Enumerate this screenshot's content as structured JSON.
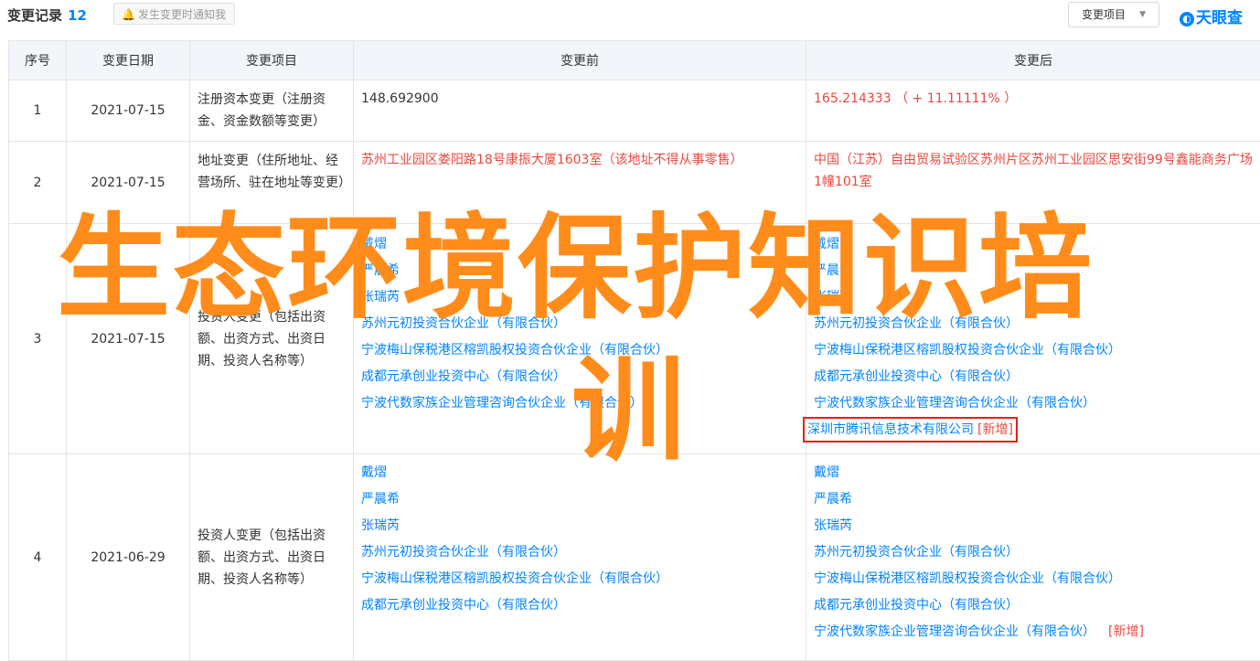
{
  "header": {
    "title": "变更记录",
    "count": "12",
    "notify_label": "发生变更时通知我",
    "filter_label": "变更项目",
    "logo_text": "天眼查"
  },
  "table": {
    "columns": [
      "序号",
      "变更日期",
      "变更项目",
      "变更前",
      "变更后"
    ],
    "rows": [
      {
        "index": "1",
        "date": "2021-07-15",
        "item": "注册资本变更（注册资金、资金数额等变更）",
        "before": [
          "148.692900"
        ],
        "after": [
          "165.214333 （ + 11.11111% ）"
        ]
      },
      {
        "index": "2",
        "date": "2021-07-15",
        "item": "地址变更（住所地址、经营场所、驻在地址等变更）",
        "before": [
          "苏州工业园区娄阳路18号康振大厦1603室（该地址不得从事零售）"
        ],
        "after": [
          "中国（江苏）自由贸易试验区苏州片区苏州工业园区思安街99号鑫能商务广场1幢101室"
        ]
      },
      {
        "index": "3",
        "date": "2021-07-15",
        "item": "投资人变更（包括出资额、出资方式、出资日期、投资人名称等）",
        "before": [
          "戴熠",
          "严晨希",
          "张瑞芮",
          "苏州元初投资合伙企业（有限合伙）",
          "宁波梅山保税港区榕凯股权投资合伙企业（有限合伙）",
          "成都元承创业投资中心（有限合伙）",
          "宁波代数家族企业管理咨询合伙企业（有限合伙）"
        ],
        "after": [
          "戴熠",
          "严晨希",
          "张瑞芮",
          "苏州元初投资合伙企业（有限合伙）",
          "宁波梅山保税港区榕凯股权投资合伙企业（有限合伙）",
          "成都元承创业投资中心（有限合伙）",
          "宁波代数家族企业管理咨询合伙企业（有限合伙）"
        ],
        "after_added": "深圳市腾讯信息技术有限公司",
        "added_tag": "[新增]"
      },
      {
        "index": "4",
        "date": "2021-06-29",
        "item": "投资人变更（包括出资额、出资方式、出资日期、投资人名称等）",
        "before": [
          "戴熠",
          "严晨希",
          "张瑞芮",
          "苏州元初投资合伙企业（有限合伙）",
          "宁波梅山保税港区榕凯股权投资合伙企业（有限合伙）",
          "成都元承创业投资中心（有限合伙）"
        ],
        "after": [
          "戴熠",
          "严晨希",
          "张瑞芮",
          "苏州元初投资合伙企业（有限合伙）",
          "宁波梅山保税港区榕凯股权投资合伙企业（有限合伙）",
          "成都元承创业投资中心（有限合伙）",
          "宁波代数家族企业管理咨询合伙企业（有限合伙）"
        ],
        "after_added_tag": "[新增]"
      }
    ]
  },
  "overlay": {
    "line1": "生态环境保护知识培",
    "line2": "训",
    "color": "#ff8c1a"
  },
  "colors": {
    "accent": "#0084ff",
    "red": "#e8483e",
    "header_bg": "#f2f5f9"
  }
}
